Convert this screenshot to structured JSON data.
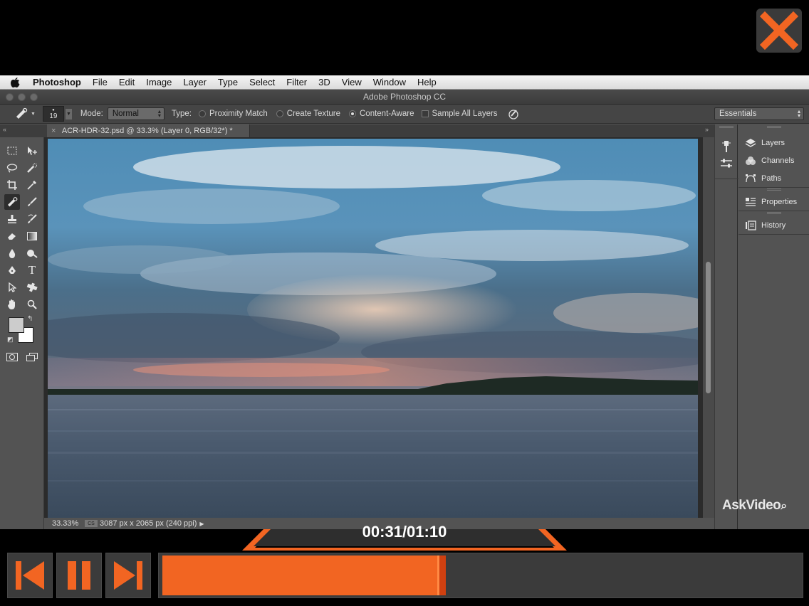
{
  "player": {
    "time": "00:31/01:10",
    "progress_fraction": 0.445,
    "accent_color": "#f26522",
    "icons": [
      "close-icon",
      "skip-back-icon",
      "pause-icon",
      "skip-forward-icon"
    ]
  },
  "menubar": {
    "app_name": "Photoshop",
    "items": [
      "File",
      "Edit",
      "Image",
      "Layer",
      "Type",
      "Select",
      "Filter",
      "3D",
      "View",
      "Window",
      "Help"
    ]
  },
  "window": {
    "title": "Adobe Photoshop CC"
  },
  "options": {
    "brush_size": "19",
    "mode_label": "Mode:",
    "mode_value": "Normal",
    "type_label": "Type:",
    "proximity_label": "Proximity Match",
    "texture_label": "Create Texture",
    "content_aware_label": "Content-Aware",
    "sample_all_label": "Sample All Layers",
    "workspace": "Essentials"
  },
  "document": {
    "tab_label": "ACR-HDR-32.psd @ 33.3% (Layer 0, RGB/32*) *",
    "zoom": "33.33%",
    "info": "3087 px x 2065 px (240 ppi)"
  },
  "panels": {
    "layers": "Layers",
    "channels": "Channels",
    "paths": "Paths",
    "properties": "Properties",
    "history": "History"
  },
  "watermark": "AskVideo"
}
